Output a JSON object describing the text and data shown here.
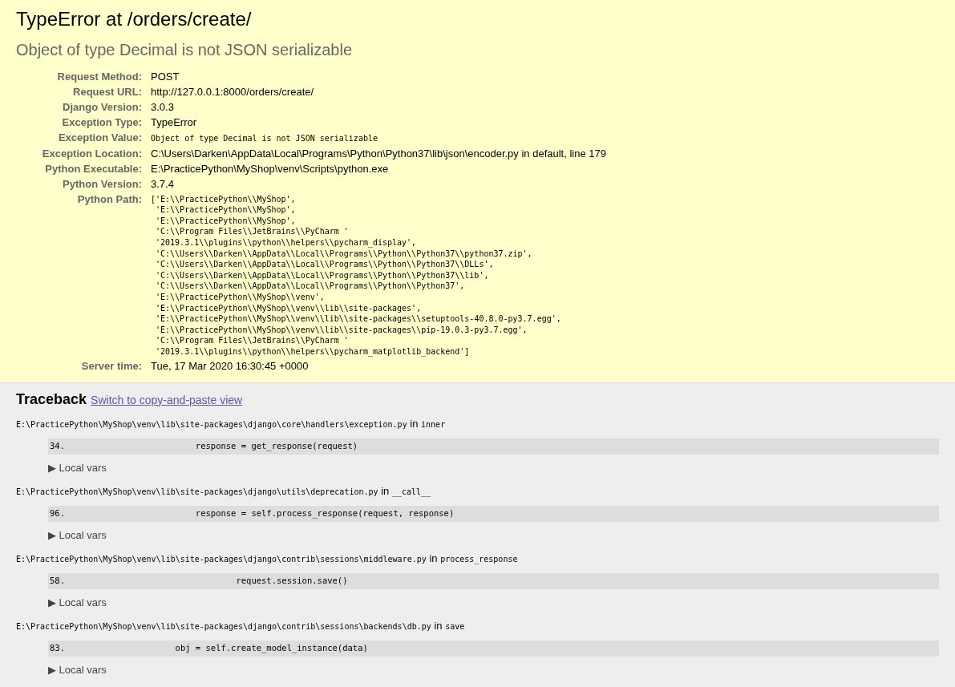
{
  "title": "TypeError at /orders/create/",
  "subtitle": "Object of type Decimal is not JSON serializable",
  "meta": [
    {
      "label": "Request Method:",
      "value": "POST",
      "kind": "text"
    },
    {
      "label": "Request URL:",
      "value": "http://127.0.0.1:8000/orders/create/",
      "kind": "text"
    },
    {
      "label": "Django Version:",
      "value": "3.0.3",
      "kind": "text"
    },
    {
      "label": "Exception Type:",
      "value": "TypeError",
      "kind": "text"
    },
    {
      "label": "Exception Value:",
      "value": "Object of type Decimal is not JSON serializable",
      "kind": "code"
    },
    {
      "label": "Exception Location:",
      "value": "C:\\Users\\Darken\\AppData\\Local\\Programs\\Python\\Python37\\lib\\json\\encoder.py in default, line 179",
      "kind": "text"
    },
    {
      "label": "Python Executable:",
      "value": "E:\\PracticePython\\MyShop\\venv\\Scripts\\python.exe",
      "kind": "text"
    },
    {
      "label": "Python Version:",
      "value": "3.7.4",
      "kind": "text"
    },
    {
      "label": "Python Path:",
      "value": "['E:\\\\PracticePython\\\\MyShop',\n 'E:\\\\PracticePython\\\\MyShop',\n 'E:\\\\PracticePython\\\\MyShop',\n 'C:\\\\Program Files\\\\JetBrains\\\\PyCharm '\n '2019.3.1\\\\plugins\\\\python\\\\helpers\\\\pycharm_display',\n 'C:\\\\Users\\\\Darken\\\\AppData\\\\Local\\\\Programs\\\\Python\\\\Python37\\\\python37.zip',\n 'C:\\\\Users\\\\Darken\\\\AppData\\\\Local\\\\Programs\\\\Python\\\\Python37\\\\DLLs',\n 'C:\\\\Users\\\\Darken\\\\AppData\\\\Local\\\\Programs\\\\Python\\\\Python37\\\\lib',\n 'C:\\\\Users\\\\Darken\\\\AppData\\\\Local\\\\Programs\\\\Python\\\\Python37',\n 'E:\\\\PracticePython\\\\MyShop\\\\venv',\n 'E:\\\\PracticePython\\\\MyShop\\\\venv\\\\lib\\\\site-packages',\n 'E:\\\\PracticePython\\\\MyShop\\\\venv\\\\lib\\\\site-packages\\\\setuptools-40.8.0-py3.7.egg',\n 'E:\\\\PracticePython\\\\MyShop\\\\venv\\\\lib\\\\site-packages\\\\pip-19.0.3-py3.7.egg',\n 'C:\\\\Program Files\\\\JetBrains\\\\PyCharm '\n '2019.3.1\\\\plugins\\\\python\\\\helpers\\\\pycharm_matplotlib_backend']",
      "kind": "pre"
    },
    {
      "label": "Server time:",
      "value": "Tue, 17 Mar 2020 16:30:45 +0000",
      "kind": "text"
    }
  ],
  "traceback": {
    "heading": "Traceback",
    "switch_link": "Switch to copy-and-paste view",
    "frames": [
      {
        "file": "E:\\PracticePython\\MyShop\\venv\\lib\\site-packages\\django\\core\\handlers\\exception.py",
        "in": "in",
        "function": "inner",
        "line_no": "34.",
        "code": "            response = get_response(request)",
        "vars_toggle": "▶ Local vars"
      },
      {
        "file": "E:\\PracticePython\\MyShop\\venv\\lib\\site-packages\\django\\utils\\deprecation.py",
        "in": "in",
        "function": "__call__",
        "line_no": "96.",
        "code": "            response = self.process_response(request, response)",
        "vars_toggle": "▶ Local vars"
      },
      {
        "file": "E:\\PracticePython\\MyShop\\venv\\lib\\site-packages\\django\\contrib\\sessions\\middleware.py",
        "in": "in",
        "function": "process_response",
        "line_no": "58.",
        "code": "                    request.session.save()",
        "vars_toggle": "▶ Local vars"
      },
      {
        "file": "E:\\PracticePython\\MyShop\\venv\\lib\\site-packages\\django\\contrib\\sessions\\backends\\db.py",
        "in": "in",
        "function": "save",
        "line_no": "83.",
        "code": "        obj = self.create_model_instance(data)",
        "vars_toggle": "▶ Local vars"
      }
    ]
  }
}
